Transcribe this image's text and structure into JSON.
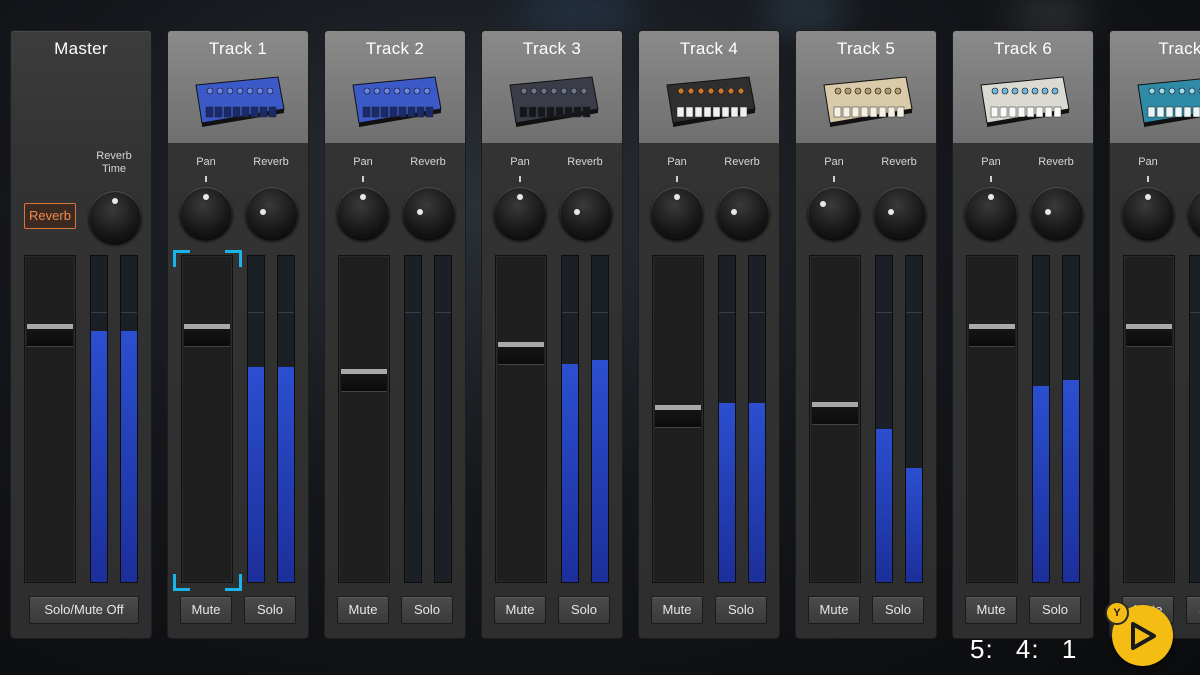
{
  "master": {
    "title": "Master",
    "reverb_time_label": "Reverb\nTime",
    "reverb_button_label": "Reverb",
    "fader_level": 0.78,
    "meter_levels": [
      0.77,
      0.77
    ],
    "solo_mute_off_label": "Solo/Mute Off"
  },
  "tracks": [
    {
      "title": "Track  1",
      "pan_label": "Pan",
      "reverb_label": "Reverb",
      "fader_level": 0.78,
      "meter_levels": [
        0.66,
        0.66
      ],
      "mute_label": "Mute",
      "solo_label": "Solo",
      "instrument_icon": "drum-machine-icon",
      "selected": true
    },
    {
      "title": "Track  2",
      "pan_label": "Pan",
      "reverb_label": "Reverb",
      "fader_level": 0.63,
      "meter_levels": [
        0.0,
        0.0
      ],
      "mute_label": "Mute",
      "solo_label": "Solo",
      "instrument_icon": "drum-machine-icon"
    },
    {
      "title": "Track  3",
      "pan_label": "Pan",
      "reverb_label": "Reverb",
      "fader_level": 0.72,
      "meter_levels": [
        0.67,
        0.68
      ],
      "mute_label": "Mute",
      "solo_label": "Solo",
      "instrument_icon": "groovebox-icon"
    },
    {
      "title": "Track  4",
      "pan_label": "Pan",
      "reverb_label": "Reverb",
      "fader_level": 0.51,
      "meter_levels": [
        0.55,
        0.55
      ],
      "mute_label": "Mute",
      "solo_label": "Solo",
      "instrument_icon": "analog-synth-icon"
    },
    {
      "title": "Track  5",
      "pan_label": "Pan",
      "reverb_label": "Reverb",
      "fader_level": 0.52,
      "meter_levels": [
        0.47,
        0.35
      ],
      "mute_label": "Mute",
      "solo_label": "Solo",
      "instrument_icon": "vintage-synth-icon"
    },
    {
      "title": "Track  6",
      "pan_label": "Pan",
      "reverb_label": "Reverb",
      "fader_level": 0.78,
      "meter_levels": [
        0.6,
        0.62
      ],
      "mute_label": "Mute",
      "solo_label": "Solo",
      "instrument_icon": "keyboard-synth-icon"
    },
    {
      "title": "Track",
      "pan_label": "Pan",
      "reverb_label": "R",
      "fader_level": 0.78,
      "meter_levels": [
        0.0,
        0.0
      ],
      "mute_label": "Mute",
      "solo_label": "Solo",
      "instrument_icon": "digital-synth-icon"
    }
  ],
  "transport": {
    "bar": "5:",
    "beat": "4:",
    "tick": "1",
    "play_badge": "Y"
  },
  "colors": {
    "meter_blue": "#2b4fd0",
    "reverb_orange": "#f08a4b",
    "selection_cyan": "#1bb4e8",
    "play_yellow": "#f5bd13"
  }
}
